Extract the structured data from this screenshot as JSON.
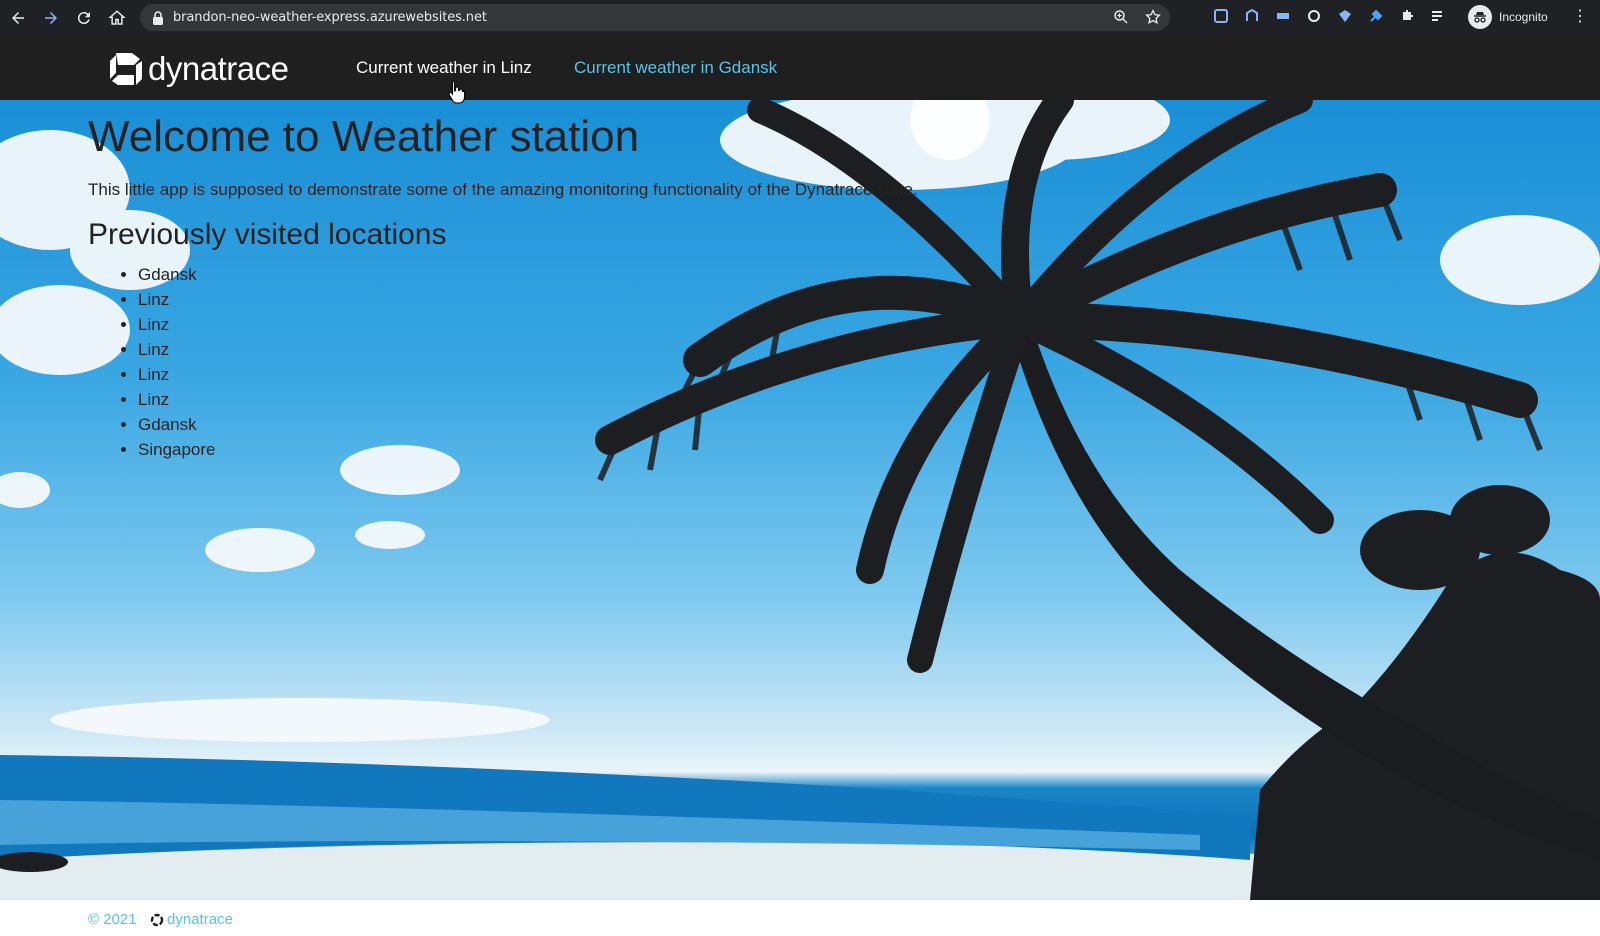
{
  "browser": {
    "url": "brandon-neo-weather-express.azurewebsites.net",
    "profile_label": "Incognito"
  },
  "site": {
    "logo_text": "dynatrace",
    "nav": [
      {
        "label": "Current weather in Linz"
      },
      {
        "label": "Current weather in Gdansk"
      }
    ]
  },
  "main": {
    "title": "Welcome to Weather station",
    "intro": "This little app is supposed to demonstrate some of the amazing monitoring functionality of the Dynatrace suite.",
    "subtitle": "Previously visited locations",
    "locations": [
      "Gdansk",
      "Linz",
      "Linz",
      "Linz",
      "Linz",
      "Linz",
      "Gdansk",
      "Singapore"
    ]
  },
  "footer": {
    "copyright": "© 2021",
    "logo_text": "dynatrace"
  },
  "colors": {
    "link_accent": "#59c3e8",
    "header_bg": "#1f1f1f",
    "chrome_bg": "#202124"
  },
  "icons": [
    "back-icon",
    "forward-icon",
    "reload-icon",
    "home-icon",
    "lock-icon",
    "zoom-icon",
    "star-icon",
    "extension-icon",
    "incognito-icon",
    "menu-icon"
  ]
}
